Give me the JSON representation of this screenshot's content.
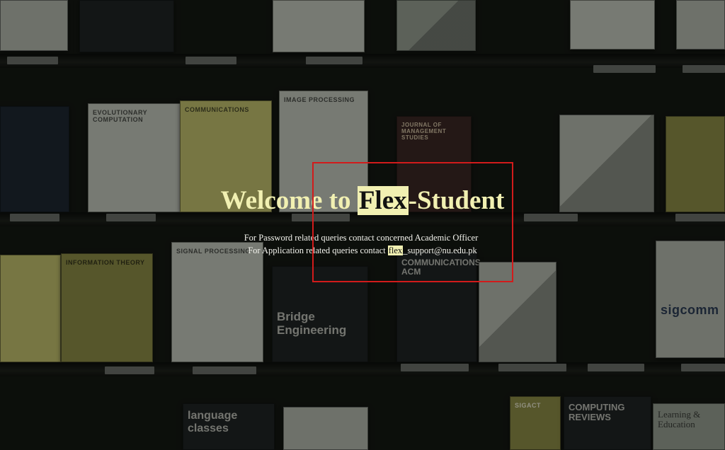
{
  "welcome": {
    "prefix": "Welcome to ",
    "highlight": "Flex",
    "suffix": "-Student"
  },
  "contact": {
    "password_line": "For Password related queries contact concerned Academic Officer",
    "application_prefix": "For Application related queries contact ",
    "email_highlight": "flex",
    "email_suffix": "_support@nu.edu.pk"
  },
  "background_titles": [
    "EVOLUTIONARY COMPUTATION",
    "COMMUNICATIONS",
    "IMAGE PROCESSING",
    "JOURNAL OF MANAGEMENT STUDIES",
    "SIGNAL PROCESSING",
    "INFORMATION THEORY",
    "Bridge Engineering",
    "COMMUNICATIONS ACM",
    "SIGCOMM",
    "SIGACT",
    "COMPUTING REVIEWS",
    "Learning & Education",
    "language classes"
  ],
  "colors": {
    "highlight": "#f1f0b2",
    "focus_box": "#d21b1b",
    "text": "#f4f4ee"
  }
}
